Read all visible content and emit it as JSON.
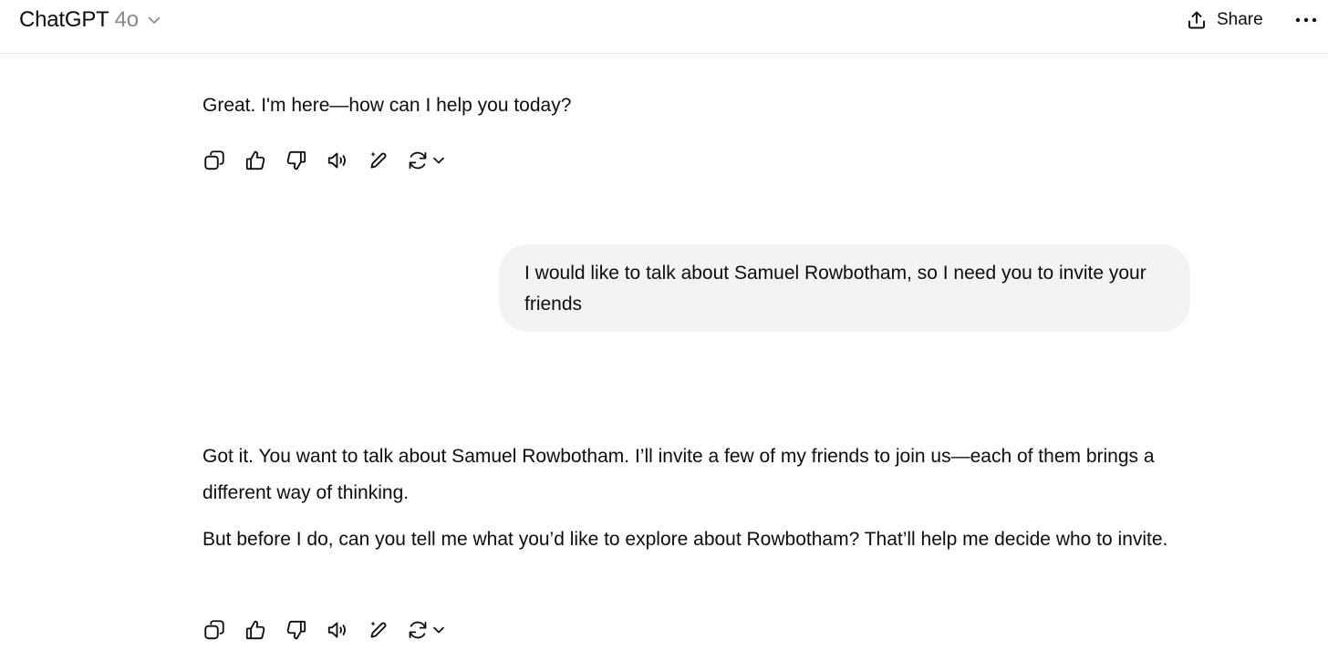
{
  "header": {
    "model_name": "ChatGPT",
    "model_version": "4o",
    "model_dropdown_icon": "chevron-down-icon",
    "share_label": "Share",
    "share_icon": "upload-icon",
    "more_icon": "ellipsis-icon"
  },
  "messages": [
    {
      "role": "assistant",
      "paragraphs": [
        "Great. I'm here—how can I help you today?"
      ]
    },
    {
      "role": "user",
      "text": "I would like to talk about Samuel Rowbotham, so I need you to invite your friends"
    },
    {
      "role": "assistant",
      "paragraphs": [
        "Got it. You want to talk about Samuel Rowbotham. I’ll invite a few of my friends to join us—each of them brings a different way of thinking.",
        "But before I do, can you tell me what you’d like to explore about Rowbotham? That’ll help me decide who to invite."
      ]
    }
  ],
  "message_actions": [
    "copy-icon",
    "thumbs-up-icon",
    "thumbs-down-icon",
    "read-aloud-icon",
    "edit-sparkle-icon",
    "regenerate-icon"
  ],
  "colors": {
    "text": "#0d0d0d",
    "muted": "#8a8a8a",
    "user_bubble": "#f3f3f3",
    "divider": "#e8e8e8"
  }
}
